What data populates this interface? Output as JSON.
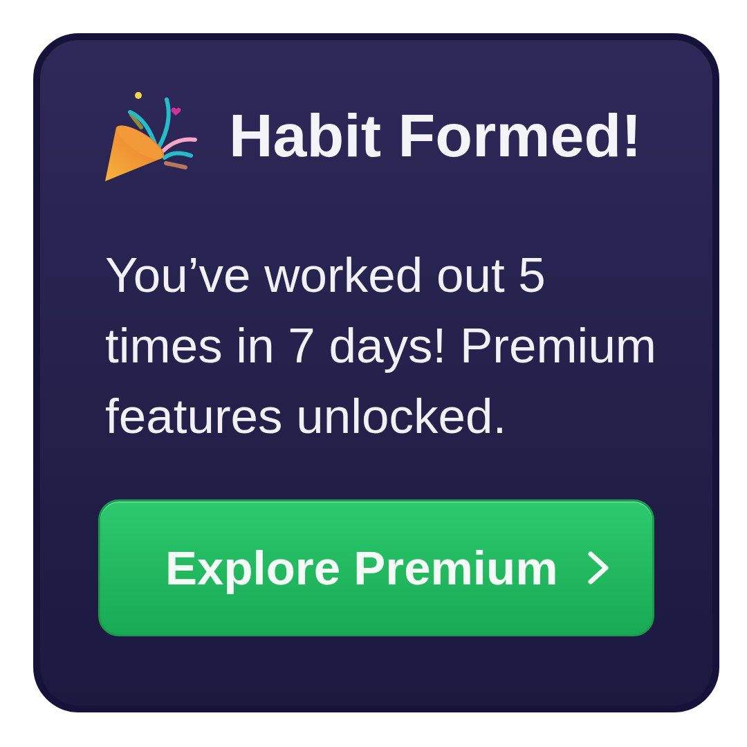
{
  "card": {
    "title": "Habit Formed!",
    "message": "You’ve worked out 5 times in 7 days! Premium features unlocked.",
    "button": {
      "label": "Explore Premium"
    }
  }
}
